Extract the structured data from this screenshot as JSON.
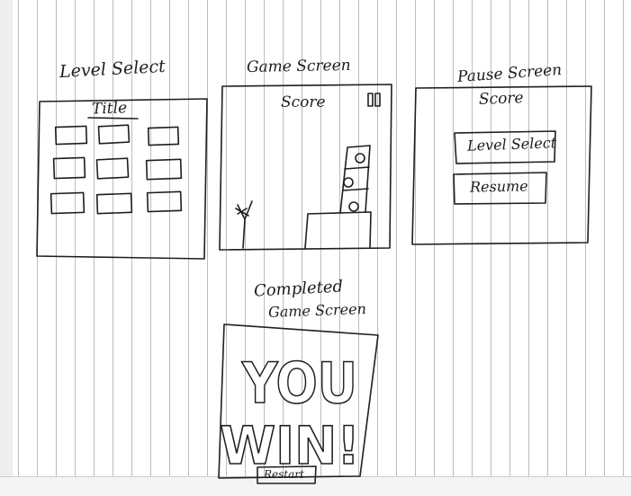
{
  "panels": {
    "level_select": {
      "heading": "Level Select",
      "title": "Title"
    },
    "game_screen": {
      "heading": "Game Screen",
      "score": "Score"
    },
    "pause_screen": {
      "heading": "Pause Screen",
      "score": "Score",
      "level_select_button": "Level Select",
      "resume_button": "Resume"
    },
    "completed_screen": {
      "heading_line1": "Completed",
      "heading_line2": "Game Screen",
      "win_line1": "YOU",
      "win_line2": "WIN!",
      "restart_button": "Restart"
    }
  },
  "colors": {
    "ink": "#1e1e1e",
    "paper": "#ffffff",
    "rule": "#bcbcbc"
  }
}
